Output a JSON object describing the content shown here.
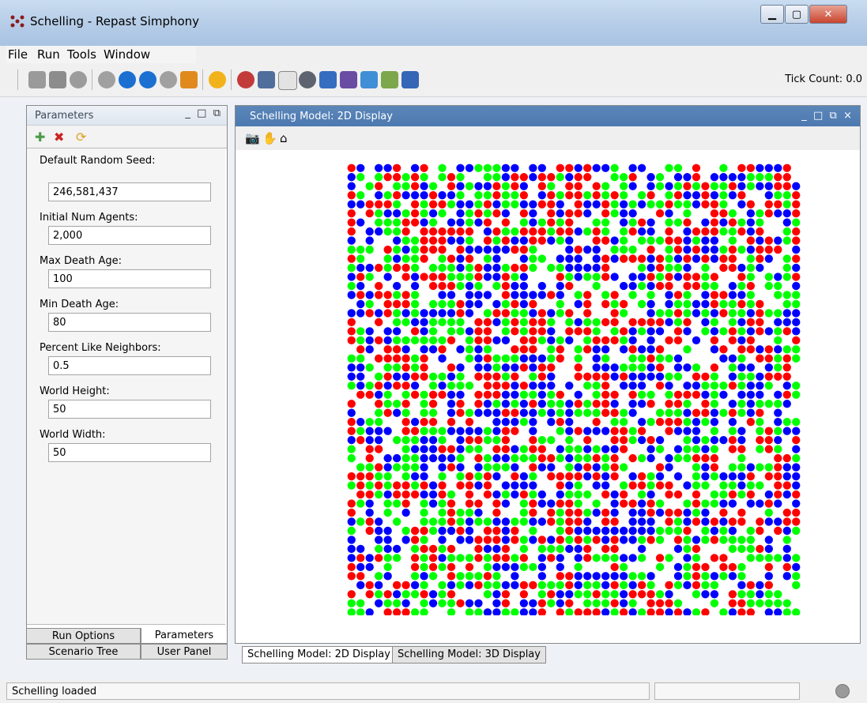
{
  "window": {
    "title": "Schelling - Repast Simphony"
  },
  "menu": [
    "File",
    "Run",
    "Tools",
    "Window"
  ],
  "toolbar": {
    "tick_count": "Tick Count: 0.0"
  },
  "left_panel": {
    "title": "Parameters",
    "fields": [
      {
        "label": "Default Random Seed:",
        "value": "246,581,437"
      },
      {
        "label": "Initial Num Agents:",
        "value": "2,000"
      },
      {
        "label": "Max Death Age:",
        "value": "100"
      },
      {
        "label": "Min Death Age:",
        "value": "80"
      },
      {
        "label": "Percent Like Neighbors:",
        "value": "0.5"
      },
      {
        "label": "World Height:",
        "value": "50"
      },
      {
        "label": "World Width:",
        "value": "50"
      }
    ],
    "tabs": [
      "Run Options",
      "Parameters",
      "Scenario Tree",
      "User Panel"
    ]
  },
  "display": {
    "title": "Schelling Model: 2D Display",
    "tabs": [
      "Schelling Model: 2D Display",
      "Schelling Model: 3D Display"
    ],
    "colors": [
      "#ff0000",
      "#00ff00",
      "#0000ff"
    ],
    "grid_size": 50
  },
  "status": {
    "text": "Schelling loaded"
  }
}
